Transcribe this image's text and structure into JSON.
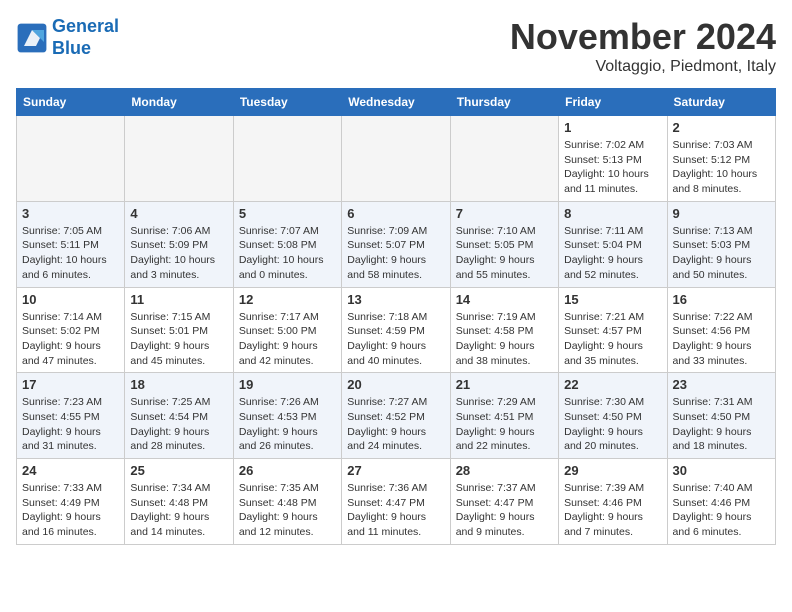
{
  "header": {
    "logo_line1": "General",
    "logo_line2": "Blue",
    "month_title": "November 2024",
    "location": "Voltaggio, Piedmont, Italy"
  },
  "weekdays": [
    "Sunday",
    "Monday",
    "Tuesday",
    "Wednesday",
    "Thursday",
    "Friday",
    "Saturday"
  ],
  "weeks": [
    [
      {
        "day": "",
        "info": ""
      },
      {
        "day": "",
        "info": ""
      },
      {
        "day": "",
        "info": ""
      },
      {
        "day": "",
        "info": ""
      },
      {
        "day": "",
        "info": ""
      },
      {
        "day": "1",
        "info": "Sunrise: 7:02 AM\nSunset: 5:13 PM\nDaylight: 10 hours and 11 minutes."
      },
      {
        "day": "2",
        "info": "Sunrise: 7:03 AM\nSunset: 5:12 PM\nDaylight: 10 hours and 8 minutes."
      }
    ],
    [
      {
        "day": "3",
        "info": "Sunrise: 7:05 AM\nSunset: 5:11 PM\nDaylight: 10 hours and 6 minutes."
      },
      {
        "day": "4",
        "info": "Sunrise: 7:06 AM\nSunset: 5:09 PM\nDaylight: 10 hours and 3 minutes."
      },
      {
        "day": "5",
        "info": "Sunrise: 7:07 AM\nSunset: 5:08 PM\nDaylight: 10 hours and 0 minutes."
      },
      {
        "day": "6",
        "info": "Sunrise: 7:09 AM\nSunset: 5:07 PM\nDaylight: 9 hours and 58 minutes."
      },
      {
        "day": "7",
        "info": "Sunrise: 7:10 AM\nSunset: 5:05 PM\nDaylight: 9 hours and 55 minutes."
      },
      {
        "day": "8",
        "info": "Sunrise: 7:11 AM\nSunset: 5:04 PM\nDaylight: 9 hours and 52 minutes."
      },
      {
        "day": "9",
        "info": "Sunrise: 7:13 AM\nSunset: 5:03 PM\nDaylight: 9 hours and 50 minutes."
      }
    ],
    [
      {
        "day": "10",
        "info": "Sunrise: 7:14 AM\nSunset: 5:02 PM\nDaylight: 9 hours and 47 minutes."
      },
      {
        "day": "11",
        "info": "Sunrise: 7:15 AM\nSunset: 5:01 PM\nDaylight: 9 hours and 45 minutes."
      },
      {
        "day": "12",
        "info": "Sunrise: 7:17 AM\nSunset: 5:00 PM\nDaylight: 9 hours and 42 minutes."
      },
      {
        "day": "13",
        "info": "Sunrise: 7:18 AM\nSunset: 4:59 PM\nDaylight: 9 hours and 40 minutes."
      },
      {
        "day": "14",
        "info": "Sunrise: 7:19 AM\nSunset: 4:58 PM\nDaylight: 9 hours and 38 minutes."
      },
      {
        "day": "15",
        "info": "Sunrise: 7:21 AM\nSunset: 4:57 PM\nDaylight: 9 hours and 35 minutes."
      },
      {
        "day": "16",
        "info": "Sunrise: 7:22 AM\nSunset: 4:56 PM\nDaylight: 9 hours and 33 minutes."
      }
    ],
    [
      {
        "day": "17",
        "info": "Sunrise: 7:23 AM\nSunset: 4:55 PM\nDaylight: 9 hours and 31 minutes."
      },
      {
        "day": "18",
        "info": "Sunrise: 7:25 AM\nSunset: 4:54 PM\nDaylight: 9 hours and 28 minutes."
      },
      {
        "day": "19",
        "info": "Sunrise: 7:26 AM\nSunset: 4:53 PM\nDaylight: 9 hours and 26 minutes."
      },
      {
        "day": "20",
        "info": "Sunrise: 7:27 AM\nSunset: 4:52 PM\nDaylight: 9 hours and 24 minutes."
      },
      {
        "day": "21",
        "info": "Sunrise: 7:29 AM\nSunset: 4:51 PM\nDaylight: 9 hours and 22 minutes."
      },
      {
        "day": "22",
        "info": "Sunrise: 7:30 AM\nSunset: 4:50 PM\nDaylight: 9 hours and 20 minutes."
      },
      {
        "day": "23",
        "info": "Sunrise: 7:31 AM\nSunset: 4:50 PM\nDaylight: 9 hours and 18 minutes."
      }
    ],
    [
      {
        "day": "24",
        "info": "Sunrise: 7:33 AM\nSunset: 4:49 PM\nDaylight: 9 hours and 16 minutes."
      },
      {
        "day": "25",
        "info": "Sunrise: 7:34 AM\nSunset: 4:48 PM\nDaylight: 9 hours and 14 minutes."
      },
      {
        "day": "26",
        "info": "Sunrise: 7:35 AM\nSunset: 4:48 PM\nDaylight: 9 hours and 12 minutes."
      },
      {
        "day": "27",
        "info": "Sunrise: 7:36 AM\nSunset: 4:47 PM\nDaylight: 9 hours and 11 minutes."
      },
      {
        "day": "28",
        "info": "Sunrise: 7:37 AM\nSunset: 4:47 PM\nDaylight: 9 hours and 9 minutes."
      },
      {
        "day": "29",
        "info": "Sunrise: 7:39 AM\nSunset: 4:46 PM\nDaylight: 9 hours and 7 minutes."
      },
      {
        "day": "30",
        "info": "Sunrise: 7:40 AM\nSunset: 4:46 PM\nDaylight: 9 hours and 6 minutes."
      }
    ]
  ]
}
